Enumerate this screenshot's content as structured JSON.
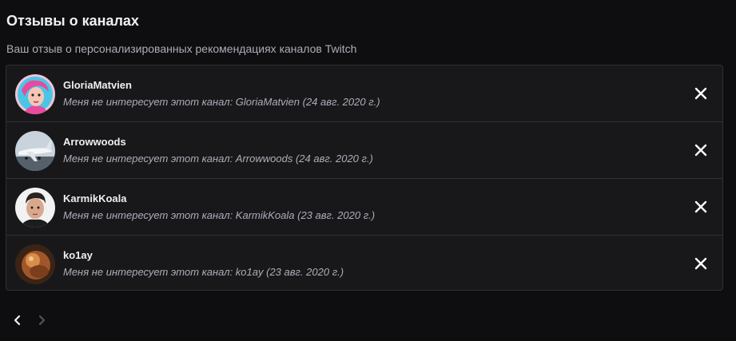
{
  "header": {
    "title": "Отзывы о каналах",
    "subtitle": "Ваш отзыв о персонализированных рекомендациях каналов Twitch"
  },
  "feedback": [
    {
      "name": "GloriaMatvien",
      "reason": "Меня не интересует этот канал: GloriaMatvien (24 авг. 2020 г.)",
      "avatar": "pink-portrait-avatar"
    },
    {
      "name": "Arrowwoods",
      "reason": "Меня не интересует этот канал: Arrowwoods (24 авг. 2020 г.)",
      "avatar": "airplane-avatar"
    },
    {
      "name": "KarmikKoala",
      "reason": "Меня не интересует этот канал: KarmikKoala (23 авг. 2020 г.)",
      "avatar": "man-portrait-avatar"
    },
    {
      "name": "ko1ay",
      "reason": "Меня не интересует этот канал: ko1ay (23 авг. 2020 г.)",
      "avatar": "bronze-figure-avatar"
    }
  ],
  "pagination": {
    "prev_icon": "chevron-left-icon",
    "next_icon": "chevron-right-icon"
  },
  "colors": {
    "background": "#0e0e10",
    "panel": "#18181b",
    "border": "#2f2f35",
    "text_primary": "#efeff1",
    "text_secondary": "#adadb8"
  }
}
